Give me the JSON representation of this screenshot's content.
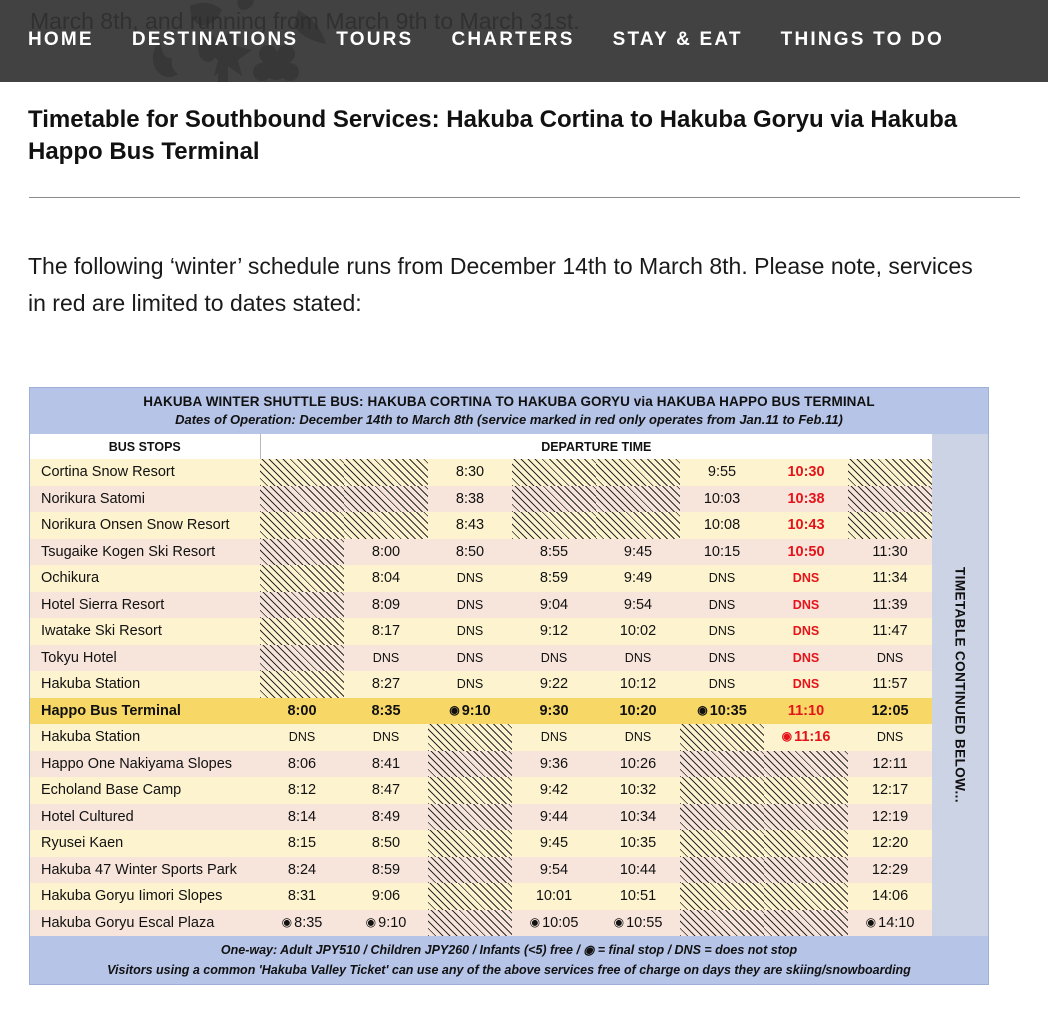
{
  "nav": {
    "items": [
      "HOME",
      "DESTINATIONS",
      "TOURS",
      "CHARTERS",
      "STAY & EAT",
      "THINGS TO DO"
    ],
    "background_text": "March 8th, and running from March 9th to March 31st."
  },
  "article": {
    "title": "Timetable for Southbound Services: Hakuba Cortina to Hakuba Goryu via Hakuba Happo Bus Terminal",
    "intro": "The following ‘winter’ schedule runs from December 14th to March 8th. Please note, services in red are limited to dates stated:"
  },
  "timetable": {
    "title": "HAKUBA WINTER SHUTTLE BUS: HAKUBA CORTINA TO HAKUBA GORYU via HAKUBA HAPPO BUS TERMINAL",
    "subtitle": "Dates of Operation: December 14th to March 8th (service marked in red only operates from Jan.11 to Feb.11)",
    "col_stops": "BUS STOPS",
    "col_departure": "DEPARTURE TIME",
    "side_note": "TIMETABLE CONTINUED BELOW...",
    "footer_line1": "One-way: Adult JPY510 / Children JPY260 / Infants (<5) free / ◉ = final stop / DNS = does not stop",
    "footer_line2": "Visitors using a common 'Hakuba Valley Ticket' can use any of the above services free of charge on days they are skiing/snowboarding",
    "final_stop_symbol": "◉",
    "red_hex": "#e4141a",
    "highlight_hex": "#f7d765",
    "header_hex": "#b6c4e7",
    "rows": [
      {
        "stop": "Cortina Snow Resort",
        "highlight": false,
        "times": [
          "hatch",
          "hatch",
          "8:30",
          "hatch",
          "hatch",
          "9:55",
          "10:30",
          "hatch"
        ]
      },
      {
        "stop": "Norikura Satomi",
        "highlight": false,
        "times": [
          "hatch",
          "hatch",
          "8:38",
          "hatch",
          "hatch",
          "10:03",
          "10:38",
          "hatch"
        ]
      },
      {
        "stop": "Norikura Onsen Snow Resort",
        "highlight": false,
        "times": [
          "hatch",
          "hatch",
          "8:43",
          "hatch",
          "hatch",
          "10:08",
          "10:43",
          "hatch"
        ]
      },
      {
        "stop": "Tsugaike Kogen Ski Resort",
        "highlight": false,
        "times": [
          "hatch",
          "8:00",
          "8:50",
          "8:55",
          "9:45",
          "10:15",
          "10:50",
          "11:30"
        ]
      },
      {
        "stop": "Ochikura",
        "highlight": false,
        "times": [
          "hatch",
          "8:04",
          "DNS",
          "8:59",
          "9:49",
          "DNS",
          "DNS",
          "11:34"
        ]
      },
      {
        "stop": "Hotel Sierra Resort",
        "highlight": false,
        "times": [
          "hatch",
          "8:09",
          "DNS",
          "9:04",
          "9:54",
          "DNS",
          "DNS",
          "11:39"
        ]
      },
      {
        "stop": "Iwatake Ski Resort",
        "highlight": false,
        "times": [
          "hatch",
          "8:17",
          "DNS",
          "9:12",
          "10:02",
          "DNS",
          "DNS",
          "11:47"
        ]
      },
      {
        "stop": "Tokyu Hotel",
        "highlight": false,
        "times": [
          "hatch",
          "DNS",
          "DNS",
          "DNS",
          "DNS",
          "DNS",
          "DNS",
          "DNS"
        ]
      },
      {
        "stop": "Hakuba Station",
        "highlight": false,
        "times": [
          "hatch",
          "8:27",
          "DNS",
          "9:22",
          "10:12",
          "DNS",
          "DNS",
          "11:57"
        ]
      },
      {
        "stop": "Happo Bus Terminal",
        "highlight": true,
        "times": [
          "8:00",
          "8:35",
          "◉ 9:10",
          "9:30",
          "10:20",
          "◉ 10:35",
          "11:10",
          "12:05"
        ]
      },
      {
        "stop": "Hakuba Station",
        "highlight": false,
        "times": [
          "DNS",
          "DNS",
          "hatch",
          "DNS",
          "DNS",
          "hatch",
          "◉ 11:16",
          "DNS"
        ]
      },
      {
        "stop": "Happo One Nakiyama Slopes",
        "highlight": false,
        "times": [
          "8:06",
          "8:41",
          "hatch",
          "9:36",
          "10:26",
          "hatch",
          "hatch",
          "12:11"
        ]
      },
      {
        "stop": "Echoland Base Camp",
        "highlight": false,
        "times": [
          "8:12",
          "8:47",
          "hatch",
          "9:42",
          "10:32",
          "hatch",
          "hatch",
          "12:17"
        ]
      },
      {
        "stop": "Hotel Cultured",
        "highlight": false,
        "times": [
          "8:14",
          "8:49",
          "hatch",
          "9:44",
          "10:34",
          "hatch",
          "hatch",
          "12:19"
        ]
      },
      {
        "stop": "Ryusei Kaen",
        "highlight": false,
        "times": [
          "8:15",
          "8:50",
          "hatch",
          "9:45",
          "10:35",
          "hatch",
          "hatch",
          "12:20"
        ]
      },
      {
        "stop": "Hakuba 47 Winter Sports Park",
        "highlight": false,
        "times": [
          "8:24",
          "8:59",
          "hatch",
          "9:54",
          "10:44",
          "hatch",
          "hatch",
          "12:29"
        ]
      },
      {
        "stop": "Hakuba Goryu Iimori Slopes",
        "highlight": false,
        "times": [
          "8:31",
          "9:06",
          "hatch",
          "10:01",
          "10:51",
          "hatch",
          "hatch",
          "14:06"
        ]
      },
      {
        "stop": "Hakuba Goryu Escal Plaza",
        "highlight": false,
        "times": [
          "◉ 8:35",
          "◉ 9:10",
          "hatch",
          "◉ 10:05",
          "◉ 10:55",
          "hatch",
          "hatch",
          "◉ 14:10"
        ]
      }
    ],
    "red_columns": [
      6
    ]
  }
}
